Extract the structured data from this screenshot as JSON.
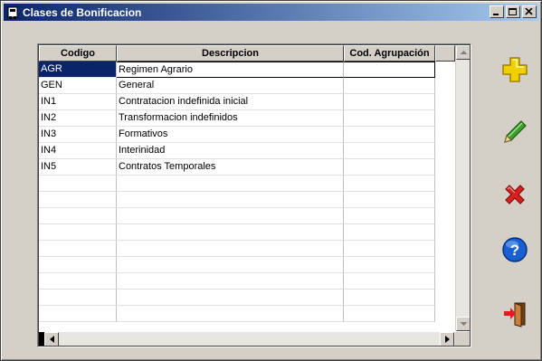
{
  "window": {
    "title": "Clases de Bonificacion",
    "controls": [
      "minimize-icon",
      "maximize-icon",
      "close-icon"
    ]
  },
  "grid": {
    "columns": [
      "Codigo",
      "Descripcion",
      "Cod. Agrupación"
    ],
    "rows": [
      {
        "codigo": "AGR",
        "descripcion": "Regimen Agrario",
        "agrupacion": ""
      },
      {
        "codigo": "GEN",
        "descripcion": "General",
        "agrupacion": ""
      },
      {
        "codigo": "IN1",
        "descripcion": "Contratacion indefinida inicial",
        "agrupacion": ""
      },
      {
        "codigo": "IN2",
        "descripcion": "Transformacion indefinidos",
        "agrupacion": ""
      },
      {
        "codigo": "IN3",
        "descripcion": "Formativos",
        "agrupacion": ""
      },
      {
        "codigo": "IN4",
        "descripcion": "Interinidad",
        "agrupacion": ""
      },
      {
        "codigo": "IN5",
        "descripcion": "Contratos Temporales",
        "agrupacion": ""
      }
    ],
    "selected_row": 0
  },
  "toolbar": {
    "buttons": [
      "add-icon",
      "edit-pencil-icon",
      "delete-icon",
      "help-icon",
      "exit-door-icon"
    ]
  },
  "colors": {
    "title_start": "#0a246a",
    "title_end": "#a6caf0",
    "selection": "#0a246a",
    "add": "#f0d000",
    "edit": "#3ca030",
    "delete": "#d82020",
    "help": "#1860d0"
  }
}
